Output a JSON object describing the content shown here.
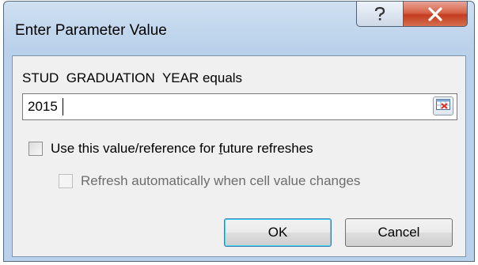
{
  "window": {
    "title": "Enter Parameter Value",
    "help_icon": "question-mark-icon",
    "close_icon": "close-x-icon"
  },
  "dialog": {
    "prompt": "STUD  GRADUATION  YEAR equals",
    "input_value": "2015",
    "ref_button_icon": "range-selector-icon",
    "use_value_label_before": "Use this value/reference for ",
    "use_value_label_accel": "f",
    "use_value_label_after": "uture refreshes",
    "use_value_checked": false,
    "refresh_label": "Refresh automatically when cell value changes",
    "refresh_checked": false,
    "refresh_enabled": false,
    "ok_label": "OK",
    "cancel_label": "Cancel"
  },
  "colors": {
    "title_bar": "#b9d1ea",
    "close_button": "#c43c20",
    "client_bg": "#f0f0f0",
    "disabled_text": "#6d6d6d"
  }
}
